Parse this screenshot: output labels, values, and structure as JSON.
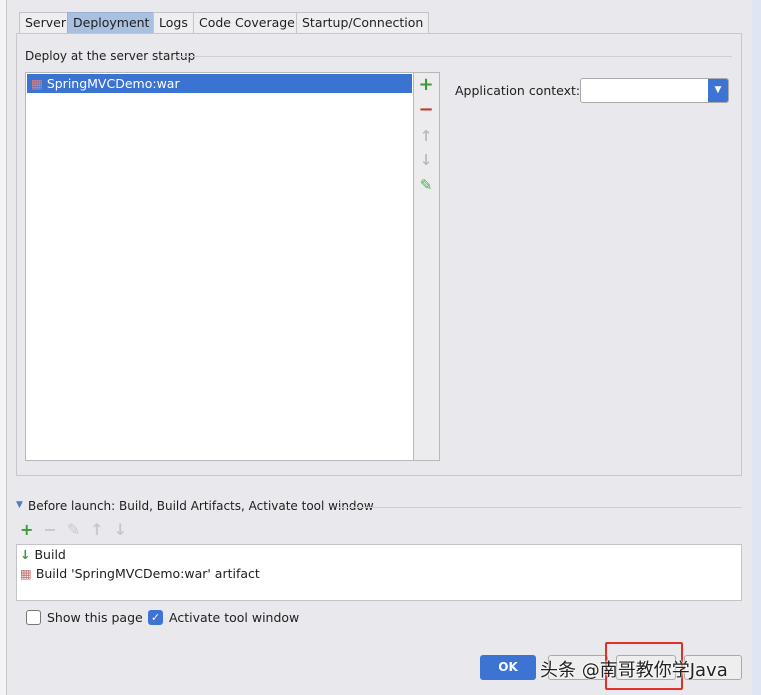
{
  "tabs": [
    {
      "label": "Server"
    },
    {
      "label": "Deployment"
    },
    {
      "label": "Logs"
    },
    {
      "label": "Code Coverage"
    },
    {
      "label": "Startup/Connection"
    }
  ],
  "deploy": {
    "title": "Deploy at the server startup",
    "items": [
      {
        "label": "SpringMVCDemo:war",
        "selected": true
      }
    ]
  },
  "app_context": {
    "label": "Application context:",
    "value": ""
  },
  "before_launch": {
    "title": "Before launch: Build, Build Artifacts, Activate tool window",
    "items": [
      {
        "label": "Build"
      },
      {
        "label": "Build 'SpringMVCDemo:war' artifact"
      }
    ]
  },
  "options": {
    "show_page": {
      "label": "Show this page",
      "checked": false
    },
    "activate_tool": {
      "label": "Activate tool window",
      "checked": true
    }
  },
  "buttons": {
    "ok": "OK"
  },
  "watermark": "头条 @南哥教你学Java",
  "colors": {
    "accent": "#3b73d0",
    "add": "#3a9a3a",
    "remove": "#c0392b",
    "highlight": "#e0302a"
  }
}
